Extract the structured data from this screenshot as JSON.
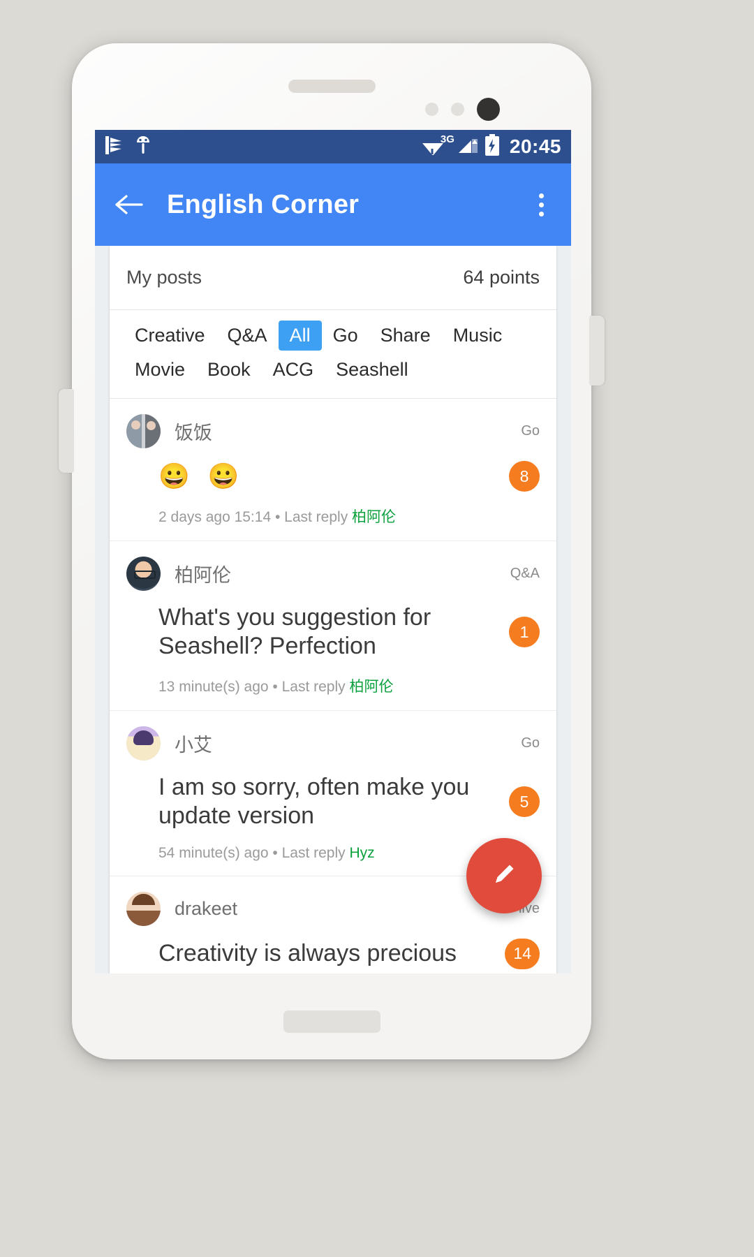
{
  "status_bar": {
    "time": "20:45",
    "network_label": "3G",
    "icons": [
      "notification-glyph-icon",
      "android-robot-icon",
      "wifi-warning-icon",
      "cellular-signal-icon",
      "battery-charging-icon"
    ],
    "background_color": "#2e4f8e"
  },
  "toolbar": {
    "title": "English Corner",
    "back_label": "back-arrow",
    "overflow_label": "more-options",
    "background_color": "#4285f4"
  },
  "header": {
    "my_posts_label": "My posts",
    "points_label": "64 points"
  },
  "categories": {
    "selected": "All",
    "accent_color": "#3ea0f2",
    "row1": [
      "Creative",
      "Q&A",
      "All",
      "Go",
      "Share",
      "Music"
    ],
    "row2": [
      "Movie",
      "Book",
      "ACG",
      "Seashell"
    ]
  },
  "posts": [
    {
      "author": "饭饭",
      "category": "Go",
      "content": "😀 😀",
      "is_emoji": true,
      "badge": "8",
      "time": "2 days ago 15:14",
      "separator": "•",
      "last_reply_label": "Last reply",
      "last_reply_user": "柏阿伦",
      "avatar": "avatar-photo-two-people"
    },
    {
      "author": "柏阿伦",
      "category": "Q&A",
      "content": "What's you suggestion for Seashell?  Perfection",
      "is_emoji": false,
      "badge": "1",
      "time": "13 minute(s) ago",
      "separator": "•",
      "last_reply_label": "Last reply",
      "last_reply_user": "柏阿伦",
      "avatar": "avatar-photo-man-glasses"
    },
    {
      "author": "小艾",
      "category": "Go",
      "content": "I am so sorry,  often make you update version",
      "is_emoji": false,
      "badge": "5",
      "time": "54 minute(s) ago",
      "separator": "•",
      "last_reply_label": "Last reply",
      "last_reply_user": "Hyz",
      "avatar": "avatar-anime-girl"
    },
    {
      "author": "drakeet",
      "category": "live",
      "content": "Creativity is always precious",
      "is_emoji": false,
      "badge": "14",
      "time": "",
      "separator": "",
      "last_reply_label": "",
      "last_reply_user": "",
      "avatar": "avatar-cartoon-character"
    }
  ],
  "fab": {
    "label": "compose-post",
    "icon": "pencil-icon",
    "color": "#e04b3c"
  },
  "badge_color": "#f57c1f",
  "reply_user_color": "#0aa13c"
}
